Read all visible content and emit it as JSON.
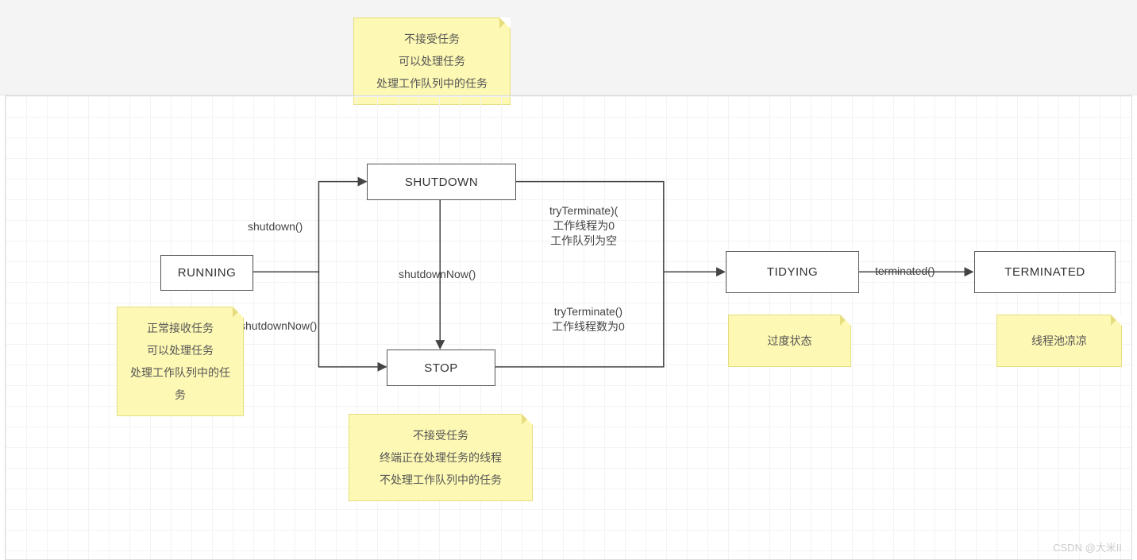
{
  "nodes": {
    "running": {
      "label": "RUNNING"
    },
    "shutdown": {
      "label": "SHUTDOWN"
    },
    "stop": {
      "label": "STOP"
    },
    "tidying": {
      "label": "TIDYING"
    },
    "terminated": {
      "label": "TERMINATED"
    }
  },
  "edges": {
    "running_to_shutdown": {
      "label": "shutdown()"
    },
    "running_to_stop": {
      "label": "shutdownNow()"
    },
    "shutdown_to_stop": {
      "label": "shutdownNow()"
    },
    "shutdown_to_tidying": {
      "label_line1": "tryTerminate)(",
      "label_line2": "工作线程为0",
      "label_line3": "工作队列为空"
    },
    "stop_to_tidying": {
      "label_line1": "tryTerminate()",
      "label_line2": "工作线程数为0"
    },
    "tidying_to_terminated": {
      "label": "terminated()"
    }
  },
  "notes": {
    "shutdown_note": {
      "line1": "不接受任务",
      "line2": "可以处理任务",
      "line3": "处理工作队列中的任务"
    },
    "running_note": {
      "line1": "正常接收任务",
      "line2": "可以处理任务",
      "line3": "处理工作队列中的任务"
    },
    "stop_note": {
      "line1": "不接受任务",
      "line2": "终端正在处理任务的线程",
      "line3": "不处理工作队列中的任务"
    },
    "tidying_note": {
      "line1": "过度状态"
    },
    "terminated_note": {
      "line1": "线程池凉凉"
    }
  },
  "watermark": "CSDN @大米II"
}
